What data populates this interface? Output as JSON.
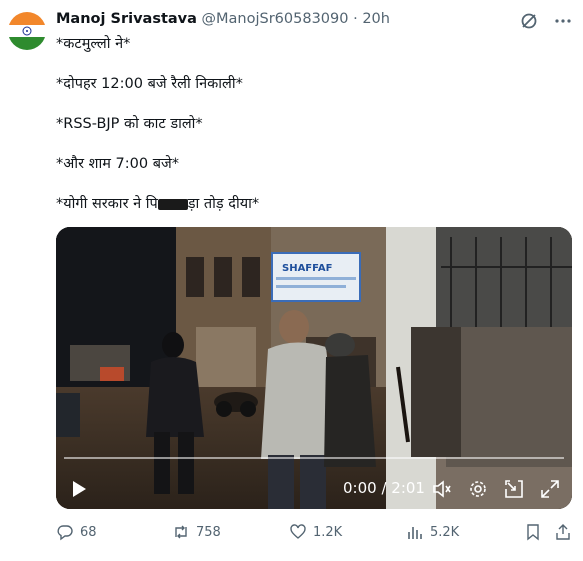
{
  "tweet": {
    "author_name": "Manoj Srivastava",
    "handle": "@ManojSr60583090",
    "separator": "·",
    "time": "20h",
    "lines": [
      "*कटमुल्लो ने*",
      "*दोपहर 12:00 बजे रैली निकाली*",
      "*RSS-BJP को काट डालो*",
      "*और शाम 7:00 बजे*"
    ],
    "last_line_start": "*योगी सरकार ने पि",
    "last_line_end": "ड़ा तोड़ दीया*"
  },
  "video": {
    "time_label": "0:00 / 2:01",
    "sign_text": "SHAFFAF",
    "progress": 0.0
  },
  "actions": {
    "replies": "68",
    "reposts": "758",
    "likes": "1.2K",
    "views": "5.2K"
  },
  "colors": {
    "muted": "#536471",
    "text": "#0f1419"
  },
  "icons": [
    "grok-icon",
    "more-icon",
    "play-icon",
    "volume-icon",
    "settings-icon",
    "pip-icon",
    "fullscreen-icon",
    "reply-icon",
    "repost-icon",
    "like-icon",
    "views-icon",
    "bookmark-icon",
    "share-icon"
  ]
}
